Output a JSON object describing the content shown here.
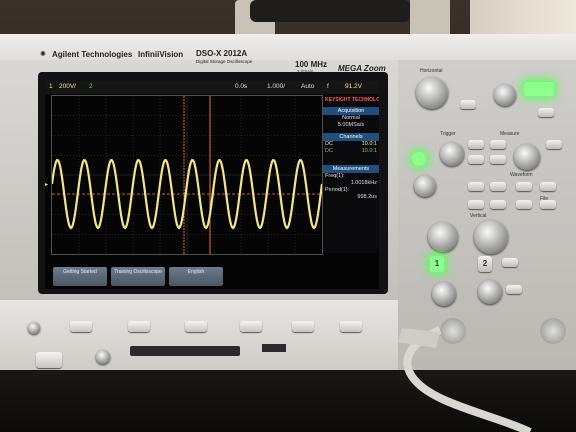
{
  "brand": {
    "maker": "Agilent Technologies",
    "series": "InfiniiVision",
    "model": "DSO-X 2012A",
    "model_sub": "Digital Storage Oscilloscope",
    "bandwidth": "100 MHz",
    "sample_rate_badge": "2 GSa/s",
    "mega_zoom": "MEGA Zoom"
  },
  "status_bar": {
    "channel": "1",
    "volts_per_div": "200V/",
    "ch2": "2",
    "delay": "0.0s",
    "time_per_div": "1.000/",
    "trigger_mode": "Auto",
    "trigger_icon": "f",
    "trigger_level": "91.2V"
  },
  "sidebar": {
    "logo": "KEYSIGHT TECHNOLOGIES",
    "acquisition": {
      "header": "Acquisition",
      "mode": "Normal",
      "rate": "5.00MSa/s"
    },
    "channels": {
      "header": "Channels",
      "rows": [
        {
          "label": "DC",
          "value": "10.0:1"
        },
        {
          "label": "DC",
          "value": "10.0:1"
        }
      ]
    },
    "measurements": {
      "header": "Measurements",
      "freq_label": "Freq(1):",
      "freq_value": "1.0018kHz",
      "period_label": "Period(1):",
      "period_value": "998.2us"
    }
  },
  "softkeys": [
    {
      "label": "Getting Started"
    },
    {
      "label": "Training Oscilloscope"
    },
    {
      "label": "English"
    }
  ],
  "panel": {
    "horizontal": "Horizontal",
    "trigger": "Trigger",
    "measure": "Measure",
    "waveform": "Waveform",
    "file": "File",
    "vertical": "Vertical",
    "ch1": "1",
    "ch2": "2"
  },
  "waveform": {
    "color": "#f2e58a",
    "marker_color": "#e8743b",
    "cycles": 10
  }
}
